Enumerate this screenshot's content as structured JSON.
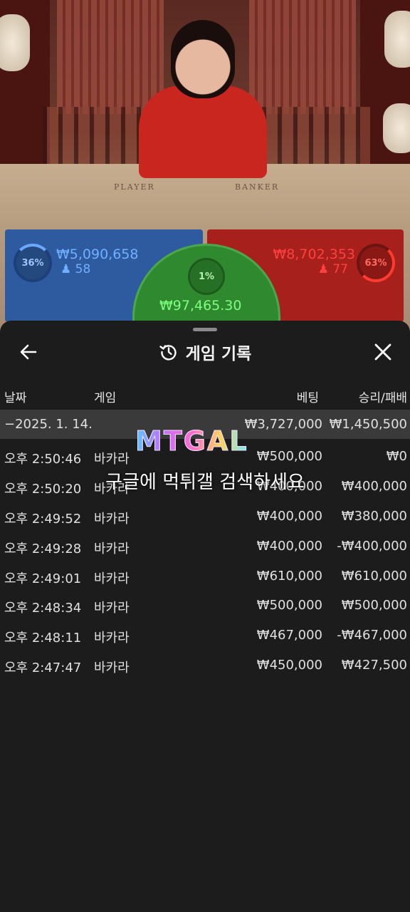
{
  "video": {
    "player_label": "PLAYER",
    "banker_label": "BANKER"
  },
  "bets": {
    "player": {
      "percent": "36%",
      "amount": "₩5,090,658",
      "count": "58",
      "color": "#2e5aa0"
    },
    "banker": {
      "percent": "63%",
      "amount": "₩8,702,353",
      "count": "77",
      "color": "#a8201c"
    },
    "tie": {
      "percent": "1%",
      "amount": "₩97,465.30",
      "color": "#2f8a2f"
    }
  },
  "sheet": {
    "title": "게임 기록",
    "back_icon": "arrow-left-icon",
    "close_icon": "close-icon",
    "history_icon": "history-icon",
    "columns": {
      "date": "날짜",
      "game": "게임",
      "bet": "베팅",
      "result": "승리/패배"
    },
    "summary": {
      "date": "−2025. 1. 14.",
      "bet": "₩3,727,000",
      "result": "₩1,450,500"
    },
    "rows": [
      {
        "time": "오후 2:50:46",
        "game": "바카라",
        "bet": "₩500,000",
        "result": "₩0"
      },
      {
        "time": "오후 2:50:20",
        "game": "바카라",
        "bet": "₩400,000",
        "result": "₩400,000"
      },
      {
        "time": "오후 2:49:52",
        "game": "바카라",
        "bet": "₩400,000",
        "result": "₩380,000"
      },
      {
        "time": "오후 2:49:28",
        "game": "바카라",
        "bet": "₩400,000",
        "result": "-₩400,000"
      },
      {
        "time": "오후 2:49:01",
        "game": "바카라",
        "bet": "₩610,000",
        "result": "₩610,000"
      },
      {
        "time": "오후 2:48:34",
        "game": "바카라",
        "bet": "₩500,000",
        "result": "₩500,000"
      },
      {
        "time": "오후 2:48:11",
        "game": "바카라",
        "bet": "₩467,000",
        "result": "-₩467,000"
      },
      {
        "time": "오후 2:47:47",
        "game": "바카라",
        "bet": "₩450,000",
        "result": "₩427,500"
      }
    ]
  },
  "watermark": {
    "logo": "MTGAL",
    "text": "구글에 먹튀갤 검색하세요"
  }
}
